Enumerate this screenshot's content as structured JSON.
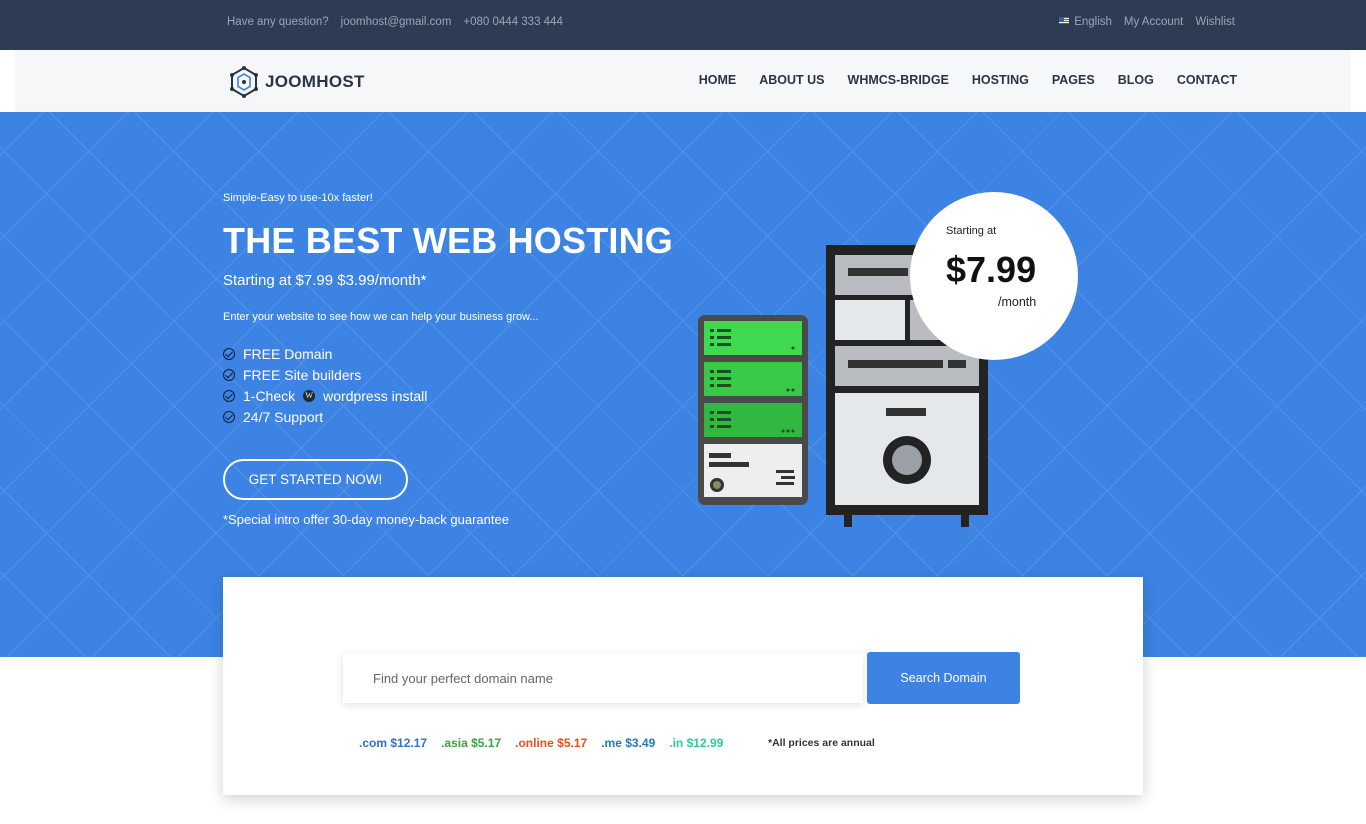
{
  "topbar": {
    "question": "Have any question?",
    "email": "joomhost@gmail.com",
    "phone": "+080 0444 333 444",
    "language": "English",
    "account": "My Account",
    "wishlist": "Wishlist"
  },
  "brand": {
    "name": "JOOMHOST",
    "icon": "hexagon-logo-icon"
  },
  "nav": {
    "items": [
      {
        "label": "HOME"
      },
      {
        "label": "ABOUT US"
      },
      {
        "label": "WHMCS-BRIDGE"
      },
      {
        "label": "HOSTING"
      },
      {
        "label": "PAGES"
      },
      {
        "label": "BLOG"
      },
      {
        "label": "CONTACT"
      }
    ]
  },
  "hero": {
    "eyebrow": "Simple-Easy to use-10x faster!",
    "headline": "THE BEST WEB HOSTING",
    "price_line": "Starting at $7.99 $3.99/month*",
    "intro": "Enter your website to see how we can help your business grow...",
    "features": [
      {
        "text": "FREE Domain"
      },
      {
        "text": "FREE Site builders"
      },
      {
        "text_before": "1-Check",
        "text_after": "wordpress install",
        "icon": "wordpress-icon"
      },
      {
        "text": "24/7 Support"
      }
    ],
    "cta": "GET STARTED NOW!",
    "guarantee": "*Special intro offer 30-day money-back guarantee",
    "badge": {
      "label": "Starting at",
      "amount": "$7.99",
      "period": "/month"
    },
    "colors": {
      "background": "#3d83e3"
    }
  },
  "domain": {
    "placeholder": "Find your perfect domain name",
    "button": "Search Domain",
    "tlds": [
      {
        "name": ".com",
        "price": "$12.17",
        "color": "#2f6fd1"
      },
      {
        "name": ".asia",
        "price": "$5.17",
        "color": "#3aa53a"
      },
      {
        "name": ".online",
        "price": "$5.17",
        "color": "#e0521b"
      },
      {
        "name": ".me",
        "price": "$3.49",
        "color": "#1f7bb6"
      },
      {
        "name": ".in",
        "price": "$12.99",
        "color": "#2fc9a0"
      }
    ],
    "note": "*All prices are annual"
  }
}
